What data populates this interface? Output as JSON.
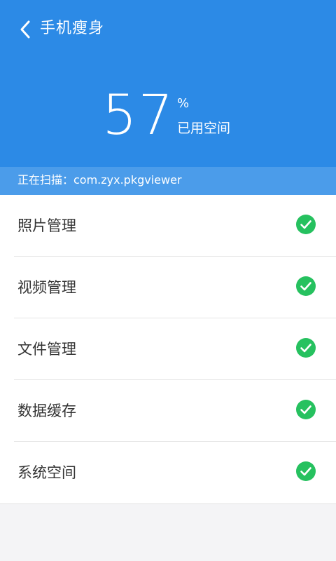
{
  "header": {
    "title": "手机瘦身",
    "back_icon": "chevron-left-icon",
    "background_color": "#2c8ae6"
  },
  "usage": {
    "value": "57",
    "unit": "%",
    "label": "已用空间"
  },
  "scan": {
    "text": "正在扫描：com.zyx.pkgviewer",
    "background_color": "#4b9cea"
  },
  "list": {
    "check_color": "#26c15f",
    "items": [
      {
        "label": "照片管理",
        "status_icon": "check-circle-icon"
      },
      {
        "label": "视频管理",
        "status_icon": "check-circle-icon"
      },
      {
        "label": "文件管理",
        "status_icon": "check-circle-icon"
      },
      {
        "label": "数据缓存",
        "status_icon": "check-circle-icon"
      },
      {
        "label": "系统空间",
        "status_icon": "check-circle-icon"
      }
    ]
  }
}
